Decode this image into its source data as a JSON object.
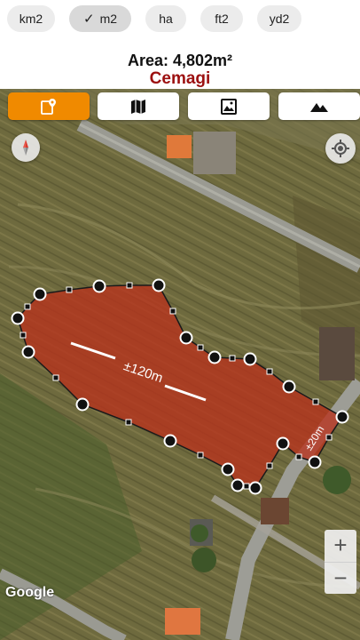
{
  "units": {
    "options": [
      {
        "label": "km2",
        "selected": false
      },
      {
        "label": "m2",
        "selected": true
      },
      {
        "label": "ha",
        "selected": false
      },
      {
        "label": "ft2",
        "selected": false
      },
      {
        "label": "yd2",
        "selected": false
      }
    ],
    "check_glyph": "✓"
  },
  "area": {
    "text": "Area: 4,802m²"
  },
  "place": {
    "text": "Cemagi"
  },
  "map": {
    "toolbar": [
      {
        "icon": "add-location-icon",
        "active": true
      },
      {
        "icon": "map-icon",
        "active": false
      },
      {
        "icon": "satellite-image-icon",
        "active": false
      },
      {
        "icon": "terrain-icon",
        "active": false
      }
    ],
    "compass_icon": "compass-icon",
    "locate_icon": "my-location-icon",
    "zoom_in_label": "+",
    "zoom_out_label": "−",
    "attribution": "Google",
    "polygon": {
      "fill_color": "#b8321c",
      "edge_labels": [
        "±120m",
        "±20m"
      ]
    },
    "colors": {
      "accent": "#f08a00",
      "place": "#9c1010"
    }
  }
}
